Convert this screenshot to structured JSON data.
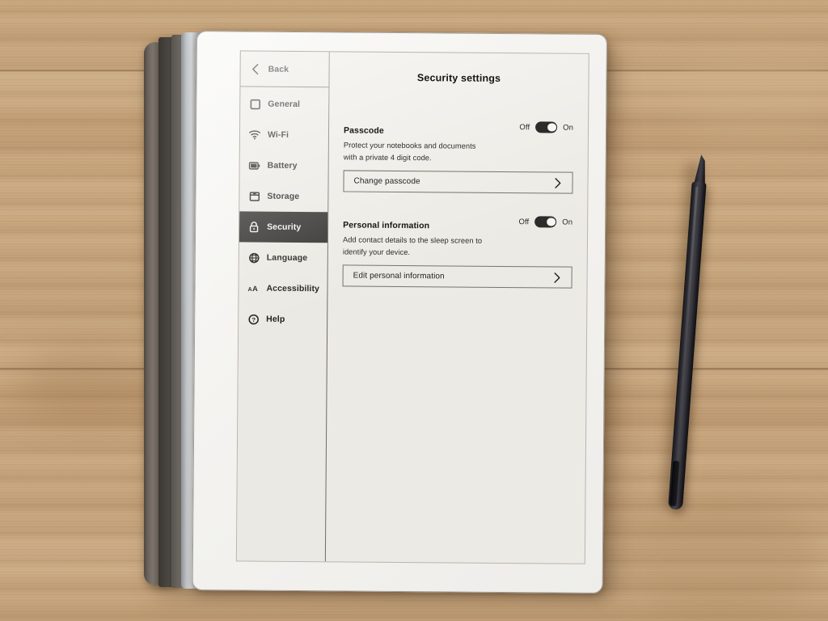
{
  "device": {
    "kind": "e-ink tablet",
    "screen_background": "#eceae4",
    "accent_dark": "#2e2c2a"
  },
  "sidebar": {
    "back": {
      "label": "Back",
      "icon": "chevron-left-icon"
    },
    "items": [
      {
        "label": "General",
        "icon": "square-icon",
        "active": false
      },
      {
        "label": "Wi-Fi",
        "icon": "wifi-icon",
        "active": false
      },
      {
        "label": "Battery",
        "icon": "battery-icon",
        "active": false
      },
      {
        "label": "Storage",
        "icon": "storage-icon",
        "active": false
      },
      {
        "label": "Security",
        "icon": "lock-icon",
        "active": true
      },
      {
        "label": "Language",
        "icon": "globe-icon",
        "active": false
      },
      {
        "label": "Accessibility",
        "icon": "text-size-icon",
        "active": false
      },
      {
        "label": "Help",
        "icon": "question-mark-icon",
        "active": false
      }
    ]
  },
  "main": {
    "title": "Security settings",
    "sections": [
      {
        "title": "Passcode",
        "description": "Protect your notebooks and documents with a private 4 digit code.",
        "toggle": {
          "off_label": "Off",
          "on_label": "On",
          "state": "on"
        },
        "button": {
          "label": "Change passcode",
          "chevron": "chevron-right-icon"
        }
      },
      {
        "title": "Personal information",
        "description": "Add contact details to the sleep screen to identify your device.",
        "toggle": {
          "off_label": "Off",
          "on_label": "On",
          "state": "on"
        },
        "button": {
          "label": "Edit personal information",
          "chevron": "chevron-right-icon"
        }
      }
    ]
  },
  "desk": {
    "surface": "light oak wood",
    "color": "#c3a178"
  },
  "stylus": {
    "name": "marker-stylus",
    "color": "#1a191e"
  }
}
